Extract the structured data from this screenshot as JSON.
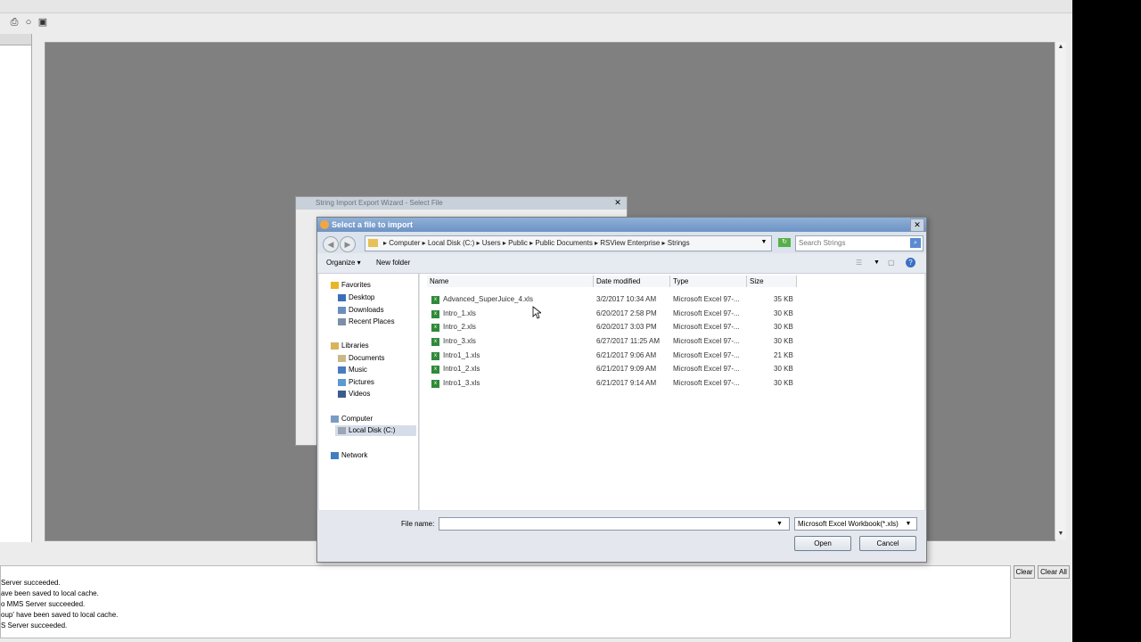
{
  "app": {
    "toolbar_icons": [
      "printer-icon",
      "circle-icon",
      "window-icon"
    ],
    "output_lines": [
      "Server succeeded.",
      "ave been saved to local cache.",
      "o MMS Server succeeded.",
      "oup' have been saved to local cache.",
      "S Server succeeded."
    ],
    "clear_button": "Clear",
    "clear_all_button": "Clear All"
  },
  "wizard": {
    "title": "String Import Export Wizard - Select File"
  },
  "dialog": {
    "title": "Select a file to import",
    "address": "▸ Computer ▸ Local Disk (C:) ▸ Users ▸ Public ▸ Public Documents ▸ RSView Enterprise ▸ Strings",
    "search_placeholder": "Search Strings",
    "organize": "Organize ▾",
    "new_folder": "New folder",
    "nav": {
      "favorites": "Favorites",
      "desktop": "Desktop",
      "downloads": "Downloads",
      "recent": "Recent Places",
      "libraries": "Libraries",
      "documents": "Documents",
      "music": "Music",
      "pictures": "Pictures",
      "videos": "Videos",
      "computer": "Computer",
      "local_disk": "Local Disk (C:)",
      "network": "Network"
    },
    "columns": {
      "name": "Name",
      "date": "Date modified",
      "type": "Type",
      "size": "Size"
    },
    "files": [
      {
        "name": "Advanced_SuperJuice_4.xls",
        "date": "3/2/2017 10:34 AM",
        "type": "Microsoft Excel 97-...",
        "size": "35 KB"
      },
      {
        "name": "Intro_1.xls",
        "date": "6/20/2017 2:58 PM",
        "type": "Microsoft Excel 97-...",
        "size": "30 KB"
      },
      {
        "name": "Intro_2.xls",
        "date": "6/20/2017 3:03 PM",
        "type": "Microsoft Excel 97-...",
        "size": "30 KB"
      },
      {
        "name": "Intro_3.xls",
        "date": "6/27/2017 11:25 AM",
        "type": "Microsoft Excel 97-...",
        "size": "30 KB"
      },
      {
        "name": "Intro1_1.xls",
        "date": "6/21/2017 9:06 AM",
        "type": "Microsoft Excel 97-...",
        "size": "21 KB"
      },
      {
        "name": "Intro1_2.xls",
        "date": "6/21/2017 9:09 AM",
        "type": "Microsoft Excel 97-...",
        "size": "30 KB"
      },
      {
        "name": "Intro1_3.xls",
        "date": "6/21/2017 9:14 AM",
        "type": "Microsoft Excel 97-...",
        "size": "30 KB"
      }
    ],
    "file_name_label": "File name:",
    "file_name_value": "",
    "file_type": "Microsoft Excel Workbook(*.xls)",
    "open_button": "Open",
    "cancel_button": "Cancel"
  }
}
